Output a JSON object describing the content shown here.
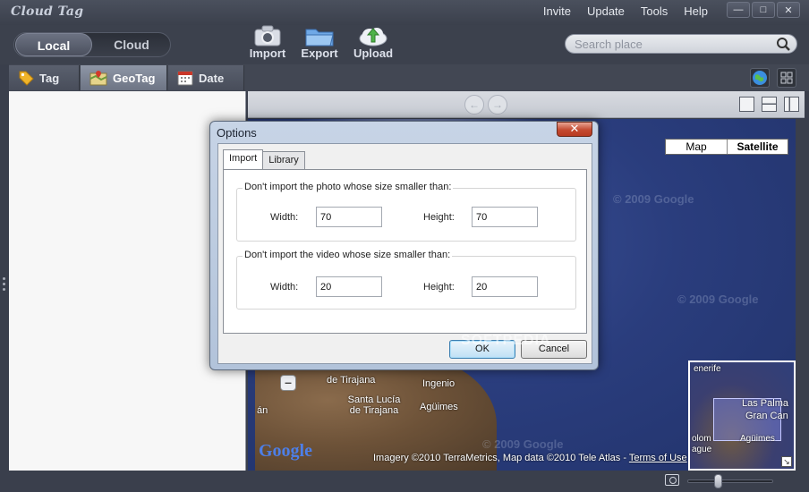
{
  "app": {
    "logo": "Cloud Tag"
  },
  "top_menu": [
    "Invite",
    "Update",
    "Tools",
    "Help"
  ],
  "window_buttons": {
    "minimize": "—",
    "maximize": "□",
    "close": "✕"
  },
  "toolbar": {
    "source_local": "Local",
    "source_cloud": "Cloud",
    "import_label": "Import",
    "export_label": "Export",
    "upload_label": "Upload"
  },
  "search": {
    "placeholder": "Search place"
  },
  "tabs": [
    {
      "label": "Tag",
      "icon": "tag-icon"
    },
    {
      "label": "GeoTag",
      "icon": "geotag-icon"
    },
    {
      "label": "Date",
      "icon": "calendar-icon"
    }
  ],
  "map": {
    "type_map": "Map",
    "type_satellite": "Satellite",
    "watermark": "© 2009 Google",
    "places": [
      "de Tirajana",
      "Santa Lucía de Tirajana",
      "Ingenio",
      "Agüimes",
      "án"
    ],
    "google_logo": "Google",
    "attribution": "Imagery ©2010 TerraMetrics, Map data ©2010 Tele Atlas - ",
    "terms": "Terms of Use",
    "overview_places": [
      "enerife",
      "Las Palma",
      "Gran Can",
      "olom",
      "ague",
      "Agüimes"
    ]
  },
  "dialog": {
    "title": "Options",
    "close": "✕",
    "tabs": [
      "Import",
      "Library"
    ],
    "photo_group": "Don't import the photo whose size smaller than:",
    "video_group": "Don't import the video whose size smaller than:",
    "width_label": "Width:",
    "height_label": "Height:",
    "photo_width": "70",
    "photo_height": "70",
    "video_width": "20",
    "video_height": "20",
    "ok": "OK",
    "cancel": "Cancel",
    "watermark": "SOFTPEDIA"
  },
  "colors": {
    "accent": "#3c414d",
    "dialog_frame": "#b8c8de",
    "close_red": "#c44a30"
  }
}
